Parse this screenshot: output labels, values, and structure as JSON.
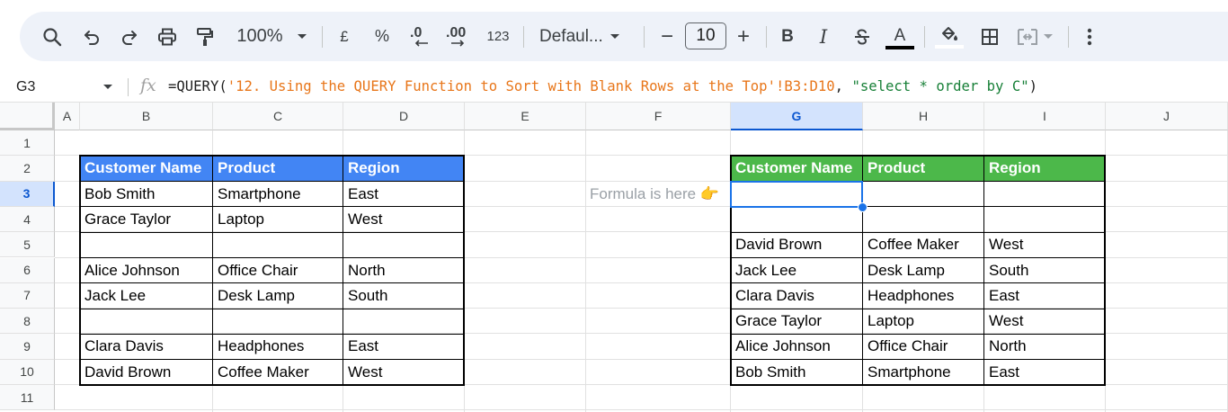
{
  "toolbar": {
    "zoom": "100%",
    "currency_label": "£",
    "percent_label": "%",
    "decrease_decimals_label": ".0",
    "increase_decimals_label": ".00",
    "number_format_label": "123",
    "font": "Defaul...",
    "minus_label": "−",
    "font_size": "10",
    "plus_label": "+",
    "bold_label": "B",
    "italic_label": "I",
    "text_color_label": "A"
  },
  "formula_bar": {
    "cell_ref": "G3",
    "fx_label": "fx",
    "formula_prefix": "=QUERY(",
    "formula_sheet_ref": "'12. Using the QUERY Function to Sort with Blank Rows at the Top'!B3:D10",
    "formula_mid": ", ",
    "formula_query": "\"select * order by C\"",
    "formula_suffix": ")"
  },
  "columns": [
    "A",
    "B",
    "C",
    "D",
    "E",
    "F",
    "G",
    "H",
    "I",
    "J"
  ],
  "rows": [
    "1",
    "2",
    "3",
    "4",
    "5",
    "6",
    "7",
    "8",
    "9",
    "10",
    "11"
  ],
  "selected_column": "G",
  "selected_row": "3",
  "source_table": {
    "headers": [
      "Customer Name",
      "Product",
      "Region"
    ],
    "rows": [
      [
        "Bob Smith",
        "Smartphone",
        "East"
      ],
      [
        "Grace Taylor",
        "Laptop",
        "West"
      ],
      [
        "",
        "",
        ""
      ],
      [
        "Alice Johnson",
        "Office Chair",
        "North"
      ],
      [
        "Jack Lee",
        "Desk Lamp",
        "South"
      ],
      [
        "",
        "",
        ""
      ],
      [
        "Clara Davis",
        "Headphones",
        "East"
      ],
      [
        "David Brown",
        "Coffee Maker",
        "West"
      ]
    ],
    "header_color": "#4285f4"
  },
  "result_table": {
    "headers": [
      "Customer Name",
      "Product",
      "Region"
    ],
    "rows": [
      [
        "",
        "",
        ""
      ],
      [
        "",
        "",
        ""
      ],
      [
        "David Brown",
        "Coffee Maker",
        "West"
      ],
      [
        "Jack Lee",
        "Desk Lamp",
        "South"
      ],
      [
        "Clara Davis",
        "Headphones",
        "East"
      ],
      [
        "Grace Taylor",
        "Laptop",
        "West"
      ],
      [
        "Alice Johnson",
        "Office Chair",
        "North"
      ],
      [
        "Bob Smith",
        "Smartphone",
        "East"
      ]
    ],
    "header_color": "#4cb84a"
  },
  "note": "Formula is here 👉",
  "colors": {
    "selection": "#1a73e8",
    "toolbar_bg": "#eef2f9",
    "note": "#9aa0a6"
  }
}
